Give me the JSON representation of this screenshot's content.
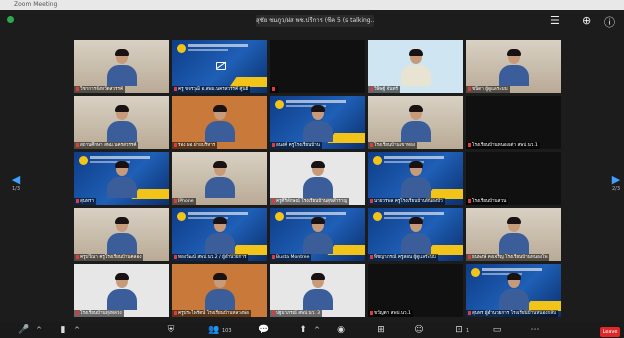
{
  "window": {
    "title": "Zoom Meeting"
  },
  "banner": {
    "talking_text": "สุชัย ชมภูว/ฝส พช.ปรีการ (ชีค 5 (s talking..."
  },
  "nav": {
    "left_page": "1/3",
    "right_page": "2/3"
  },
  "tiles": [
    {
      "name": "วิชาการจังหวัดสวรรค์",
      "bg": "room"
    },
    {
      "name": "ครู ขจรวุฒิ อ.สพม.นครสวรรค์ ศูนย์",
      "bg": "blue",
      "cam_off": true
    },
    {
      "name": "",
      "bg": "dark"
    },
    {
      "name": "วิษิษฐ์ จันทร์",
      "bg": "uniform"
    },
    {
      "name": "ชนิดา ผู้ดูแลระบบ",
      "bg": "room"
    },
    {
      "name": "สถานศึกษา สพม.นครสวรรค์",
      "bg": "room"
    },
    {
      "name": "รอง ผอ.ฝ่ายบริหาร",
      "bg": "orange"
    },
    {
      "name": "อนงค์ ครูโรงเรียนบ้าน",
      "bg": "blue"
    },
    {
      "name": "โรงเรียนบ้านเขาทอง",
      "bg": "room"
    },
    {
      "name": "โรงเรียนบ้านหนองเต่า สพป.นว.1",
      "bg": "dark"
    },
    {
      "name": "สุนทรา",
      "bg": "blue"
    },
    {
      "name": "IPhone",
      "bg": "room"
    },
    {
      "name": "ครูศิริลักษณ์ โรงเรียนบ้านสุขสำราญ",
      "bg": "light"
    },
    {
      "name": "นายวรพล ครูโรงเรียนบ้านหนองบัว",
      "bg": "blue"
    },
    {
      "name": "โรงเรียนบ้านสวน",
      "bg": "dark"
    },
    {
      "name": "ครูปวีณา ครูโรงเรียนบ้านคลอง",
      "bg": "room"
    },
    {
      "name": "ทองวัฒน์ สพป.นว.2 / ผู้อำนวยการ",
      "bg": "blue"
    },
    {
      "name": "Busta Montree",
      "bg": "blue"
    },
    {
      "name": "พิชญาภรณ์ ครูสอน ผู้ดูแลระบบ",
      "bg": "blue"
    },
    {
      "name": "ธนพงษ์ คงเจริญ โรงเรียนบ้านหนองโพ",
      "bg": "room"
    },
    {
      "name": "โรงเรียนบ้านทุ่งหลวง",
      "bg": "light"
    },
    {
      "name": "ครูประไพรัตน์ โรงเรียนบ้านหลวงพ่อ",
      "bg": "orange"
    },
    {
      "name": "ปฐมาภรณ์ สพป.นว. 3",
      "bg": "light"
    },
    {
      "name": "ขวัญตา สพป.นว.1",
      "bg": "dark"
    },
    {
      "name": "สุนทร ผู้อำนวยการ โรงเรียนบ้านหนองกลับ",
      "bg": "blue"
    }
  ],
  "toolbar": {
    "participants_count": "103",
    "chat_count": "",
    "share_count": "1"
  },
  "leave_label": "Leave",
  "colors": {
    "accent": "#3fa0ff",
    "leave": "#e02828",
    "banner_yellow": "#f2c419",
    "zoom_blue": "#1f5fb6"
  },
  "icons": [
    "mic-icon",
    "video-icon",
    "security-icon",
    "participants-icon",
    "chat-icon",
    "share-screen-icon",
    "record-icon",
    "breakout-icon",
    "reactions-icon",
    "apps-icon",
    "whiteboard-icon",
    "settings-icon",
    "zoom-icon",
    "info-icon"
  ]
}
